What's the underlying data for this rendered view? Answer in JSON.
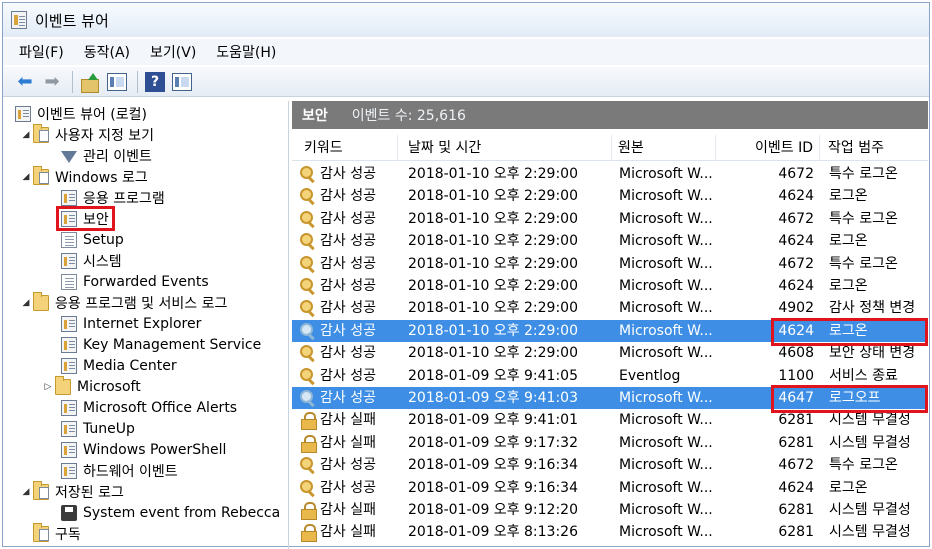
{
  "window": {
    "title": "이벤트 뷰어",
    "title_icon": "event-viewer-icon"
  },
  "menu": [
    "파일(F)",
    "동작(A)",
    "보기(V)",
    "도움말(H)"
  ],
  "toolbar": {
    "icons": [
      "back-arrow-icon",
      "forward-arrow-icon",
      "up-folder-icon",
      "show-hide-tree-icon",
      "help-icon",
      "show-hide-action-pane-icon"
    ],
    "help_glyph": "?"
  },
  "tree": {
    "items": [
      {
        "label": "이벤트 뷰어 (로컬)",
        "icon": "event-viewer-icon",
        "level": 0
      },
      {
        "label": "사용자 지정 보기",
        "icon": "folder-icon",
        "level": 1,
        "expander": "◢"
      },
      {
        "label": "관리 이벤트",
        "icon": "filter-icon",
        "level": 2
      },
      {
        "label": "Windows 로그",
        "icon": "folder-icon",
        "level": 1,
        "expander": "◢"
      },
      {
        "label": "응용 프로그램",
        "icon": "log-icon",
        "level": 2
      },
      {
        "label": "보안",
        "icon": "log-icon",
        "level": 2
      },
      {
        "label": "Setup",
        "icon": "document-icon",
        "level": 2
      },
      {
        "label": "시스템",
        "icon": "log-icon",
        "level": 2
      },
      {
        "label": "Forwarded Events",
        "icon": "document-icon",
        "level": 2
      },
      {
        "label": "응용 프로그램 및 서비스 로그",
        "icon": "folder-icon",
        "level": 1,
        "expander": "◢"
      },
      {
        "label": "Internet Explorer",
        "icon": "log-icon",
        "level": 2
      },
      {
        "label": "Key Management Service",
        "icon": "log-icon",
        "level": 2
      },
      {
        "label": "Media Center",
        "icon": "log-icon",
        "level": 2
      },
      {
        "label": "Microsoft",
        "icon": "folder-icon",
        "level": 2,
        "expander": "▷"
      },
      {
        "label": "Microsoft Office Alerts",
        "icon": "log-icon",
        "level": 2
      },
      {
        "label": "TuneUp",
        "icon": "log-icon",
        "level": 2
      },
      {
        "label": "Windows PowerShell",
        "icon": "log-icon",
        "level": 2
      },
      {
        "label": "하드웨어 이벤트",
        "icon": "log-icon",
        "level": 2
      },
      {
        "label": "저장된 로그",
        "icon": "folder-icon",
        "level": 1,
        "expander": "◢"
      },
      {
        "label": "System event from Rebecca",
        "icon": "disk-icon",
        "level": 2
      },
      {
        "label": "구독",
        "icon": "folder-icon",
        "level": 1
      }
    ]
  },
  "log_header": {
    "title": "보안",
    "count_text": "이벤트 수: 25,616"
  },
  "columns": [
    "키워드",
    "날짜 및 시간",
    "원본",
    "이벤트 ID",
    "작업 범주"
  ],
  "rows": [
    {
      "keyword": "감사 성공",
      "datetime": "2018-01-10 오후 2:29:00",
      "source": "Microsoft W...",
      "id": "4672",
      "category": "특수 로그온",
      "icon": "key-icon"
    },
    {
      "keyword": "감사 성공",
      "datetime": "2018-01-10 오후 2:29:00",
      "source": "Microsoft W...",
      "id": "4624",
      "category": "로그온",
      "icon": "key-icon"
    },
    {
      "keyword": "감사 성공",
      "datetime": "2018-01-10 오후 2:29:00",
      "source": "Microsoft W...",
      "id": "4672",
      "category": "특수 로그온",
      "icon": "key-icon"
    },
    {
      "keyword": "감사 성공",
      "datetime": "2018-01-10 오후 2:29:00",
      "source": "Microsoft W...",
      "id": "4624",
      "category": "로그온",
      "icon": "key-icon"
    },
    {
      "keyword": "감사 성공",
      "datetime": "2018-01-10 오후 2:29:00",
      "source": "Microsoft W...",
      "id": "4672",
      "category": "특수 로그온",
      "icon": "key-icon"
    },
    {
      "keyword": "감사 성공",
      "datetime": "2018-01-10 오후 2:29:00",
      "source": "Microsoft W...",
      "id": "4624",
      "category": "로그온",
      "icon": "key-icon"
    },
    {
      "keyword": "감사 성공",
      "datetime": "2018-01-10 오후 2:29:00",
      "source": "Microsoft W...",
      "id": "4902",
      "category": "감사 정책 변경",
      "icon": "key-icon"
    },
    {
      "keyword": "감사 성공",
      "datetime": "2018-01-10 오후 2:29:00",
      "source": "Microsoft W...",
      "id": "4624",
      "category": "로그온",
      "icon": "key-icon",
      "selected": true
    },
    {
      "keyword": "감사 성공",
      "datetime": "2018-01-10 오후 2:29:00",
      "source": "Microsoft W...",
      "id": "4608",
      "category": "보안 상태 변경",
      "icon": "key-icon"
    },
    {
      "keyword": "감사 성공",
      "datetime": "2018-01-09 오후 9:41:05",
      "source": "Eventlog",
      "id": "1100",
      "category": "서비스 종료",
      "icon": "key-icon"
    },
    {
      "keyword": "감사 성공",
      "datetime": "2018-01-09 오후 9:41:03",
      "source": "Microsoft W...",
      "id": "4647",
      "category": "로그오프",
      "icon": "key-icon",
      "selected": true
    },
    {
      "keyword": "감사 실패",
      "datetime": "2018-01-09 오후 9:41:01",
      "source": "Microsoft W...",
      "id": "6281",
      "category": "시스템 무결성",
      "icon": "lock-icon"
    },
    {
      "keyword": "감사 실패",
      "datetime": "2018-01-09 오후 9:17:32",
      "source": "Microsoft W...",
      "id": "6281",
      "category": "시스템 무결성",
      "icon": "lock-icon"
    },
    {
      "keyword": "감사 성공",
      "datetime": "2018-01-09 오후 9:16:34",
      "source": "Microsoft W...",
      "id": "4672",
      "category": "특수 로그온",
      "icon": "key-icon"
    },
    {
      "keyword": "감사 성공",
      "datetime": "2018-01-09 오후 9:16:34",
      "source": "Microsoft W...",
      "id": "4624",
      "category": "로그온",
      "icon": "key-icon"
    },
    {
      "keyword": "감사 실패",
      "datetime": "2018-01-09 오후 9:12:20",
      "source": "Microsoft W...",
      "id": "6281",
      "category": "시스템 무결성",
      "icon": "lock-icon"
    },
    {
      "keyword": "감사 실패",
      "datetime": "2018-01-09 오후 8:13:26",
      "source": "Microsoft W...",
      "id": "6281",
      "category": "시스템 무결성",
      "icon": "lock-icon"
    }
  ],
  "colors": {
    "selection": "#3d8ee4",
    "highlight_box": "#e0141c",
    "header_bar": "#7a7a7a"
  }
}
